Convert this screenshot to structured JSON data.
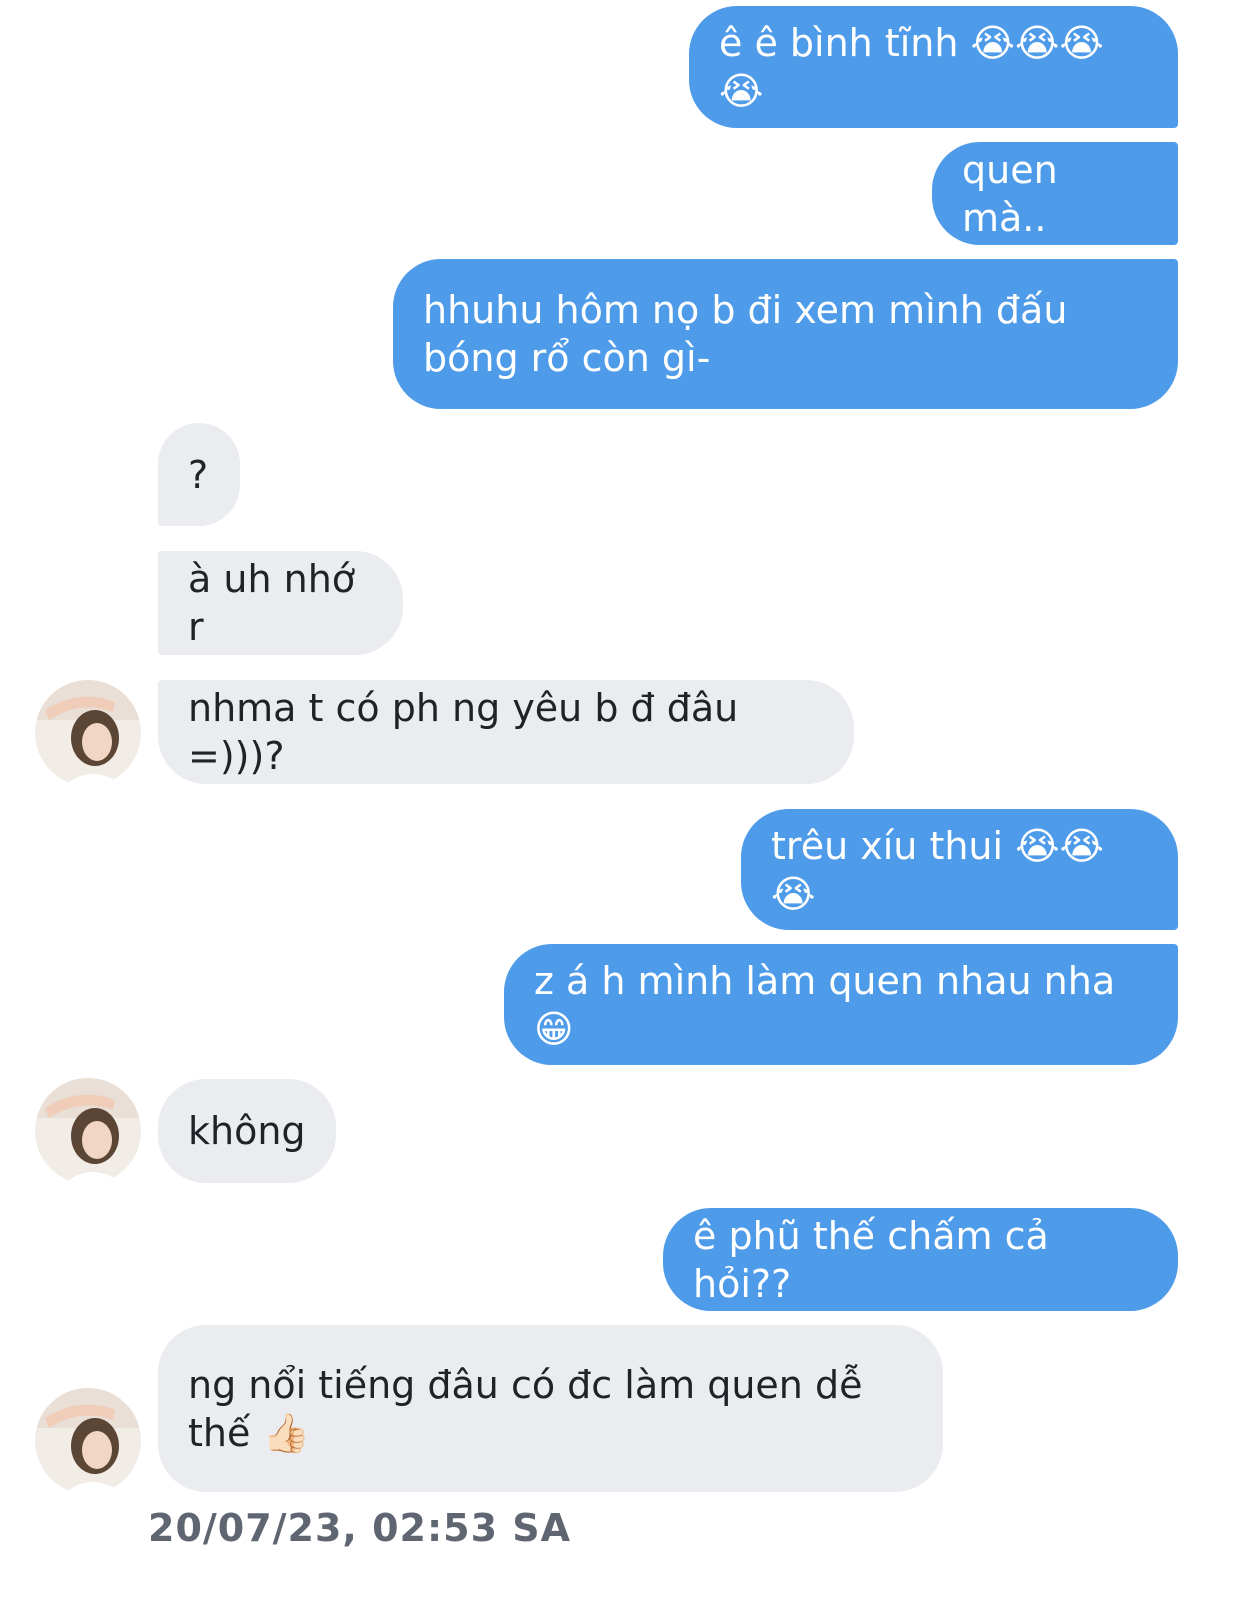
{
  "messages": [
    {
      "side": "out",
      "text": "ê ê bình tĩnh 😭😭😭😭"
    },
    {
      "side": "out",
      "text": "quen mà.."
    },
    {
      "side": "out",
      "text": "hhuhu hôm nọ b đi xem mình đấu\nbóng rổ còn gì-"
    },
    {
      "side": "in",
      "text": "?"
    },
    {
      "side": "in",
      "text": "à uh nhớ r"
    },
    {
      "side": "in",
      "text": "nhma t có ph ng yêu b đ đâu =)))?"
    },
    {
      "side": "out",
      "text": "trêu xíu thui 😭😭😭"
    },
    {
      "side": "out",
      "text": "z á h mình làm quen nhau nha 😁"
    },
    {
      "side": "in",
      "text": "không"
    },
    {
      "side": "out",
      "text": "ê phũ thế chấm cả hỏi??"
    },
    {
      "side": "in",
      "text": "ng nổi tiếng đâu có đc làm quen dễ\nthế 👍🏻"
    }
  ],
  "timestamp": "20/07/23, 02:53 SA",
  "colors": {
    "outgoing_bubble": "#4e9be9",
    "incoming_bubble": "#eaecf0",
    "timestamp": "#5f6672"
  }
}
